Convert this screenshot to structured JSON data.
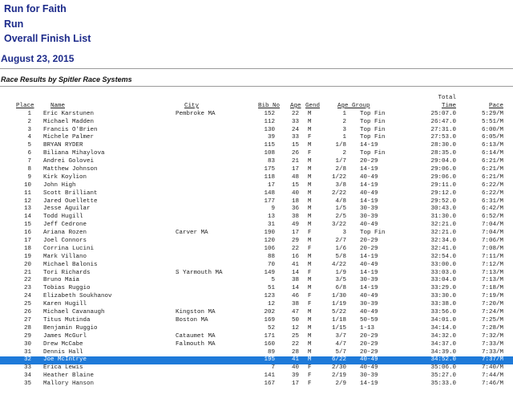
{
  "header": {
    "line1": "Run for Faith",
    "line2": "Run",
    "line3": "Overall Finish List",
    "date": "August 23, 2015",
    "subtitle": "Race Results by Spitler Race Systems"
  },
  "columns": {
    "place": "Place",
    "name": "Name",
    "city": "City",
    "bib": "Bib No",
    "age": "Age",
    "gend": "Gend",
    "group": "Age Group",
    "time_top": "Total",
    "time": "Time",
    "pace": "Pace"
  },
  "rows": [
    {
      "place": "1",
      "name": "Eric Karstunen",
      "city": "Pembroke  MA",
      "bib": "152",
      "age": "22",
      "gend": "M",
      "div": "1",
      "group": "Top Fin",
      "time": "25:07.0",
      "pace": "5:29/M"
    },
    {
      "place": "2",
      "name": "Michael Madden",
      "city": "",
      "bib": "112",
      "age": "33",
      "gend": "M",
      "div": "2",
      "group": "Top Fin",
      "time": "26:47.0",
      "pace": "5:51/M"
    },
    {
      "place": "3",
      "name": "Francis O'Brien",
      "city": "",
      "bib": "130",
      "age": "24",
      "gend": "M",
      "div": "3",
      "group": "Top Fin",
      "time": "27:31.0",
      "pace": "6:00/M"
    },
    {
      "place": "4",
      "name": "Michele Palmer",
      "city": "",
      "bib": "39",
      "age": "33",
      "gend": "F",
      "div": "1",
      "group": "Top Fin",
      "time": "27:53.0",
      "pace": "6:05/M"
    },
    {
      "place": "5",
      "name": "BRYAN RYDER",
      "city": "",
      "bib": "115",
      "age": "15",
      "gend": "M",
      "div": "1/8",
      "group": "14-19",
      "time": "28:30.0",
      "pace": "6:13/M"
    },
    {
      "place": "6",
      "name": "Biliana Mihaylova",
      "city": "",
      "bib": "108",
      "age": "26",
      "gend": "F",
      "div": "2",
      "group": "Top Fin",
      "time": "28:35.0",
      "pace": "6:14/M"
    },
    {
      "place": "7",
      "name": "Andrei Golovei",
      "city": "",
      "bib": "83",
      "age": "21",
      "gend": "M",
      "div": "1/7",
      "group": "20-29",
      "time": "29:04.0",
      "pace": "6:21/M"
    },
    {
      "place": "8",
      "name": "Matthew Johnson",
      "city": "",
      "bib": "175",
      "age": "17",
      "gend": "M",
      "div": "2/8",
      "group": "14-19",
      "time": "29:06.0",
      "pace": "6:21/M"
    },
    {
      "place": "9",
      "name": "Kirk Koylion",
      "city": "",
      "bib": "118",
      "age": "48",
      "gend": "M",
      "div": "1/22",
      "group": "40-49",
      "time": "29:06.0",
      "pace": "6:21/M"
    },
    {
      "place": "10",
      "name": "John High",
      "city": "",
      "bib": "17",
      "age": "15",
      "gend": "M",
      "div": "3/8",
      "group": "14-19",
      "time": "29:11.0",
      "pace": "6:22/M"
    },
    {
      "place": "11",
      "name": "Scott Brilliant",
      "city": "",
      "bib": "148",
      "age": "40",
      "gend": "M",
      "div": "2/22",
      "group": "40-49",
      "time": "29:12.0",
      "pace": "6:22/M"
    },
    {
      "place": "12",
      "name": "Jared Ouellette",
      "city": "",
      "bib": "177",
      "age": "18",
      "gend": "M",
      "div": "4/8",
      "group": "14-19",
      "time": "29:52.0",
      "pace": "6:31/M"
    },
    {
      "place": "13",
      "name": "Jesse Aguilar",
      "city": "",
      "bib": "9",
      "age": "36",
      "gend": "M",
      "div": "1/5",
      "group": "30-39",
      "time": "30:43.0",
      "pace": "6:42/M"
    },
    {
      "place": "14",
      "name": "Todd Hugill",
      "city": "",
      "bib": "13",
      "age": "38",
      "gend": "M",
      "div": "2/5",
      "group": "30-39",
      "time": "31:30.0",
      "pace": "6:52/M"
    },
    {
      "place": "15",
      "name": "Jeff Cedrone",
      "city": "",
      "bib": "31",
      "age": "49",
      "gend": "M",
      "div": "3/22",
      "group": "40-49",
      "time": "32:21.0",
      "pace": "7:04/M"
    },
    {
      "place": "16",
      "name": "Ariana Rozen",
      "city": "Carver  MA",
      "bib": "190",
      "age": "17",
      "gend": "F",
      "div": "3",
      "group": "Top Fin",
      "time": "32:21.0",
      "pace": "7:04/M"
    },
    {
      "place": "17",
      "name": "Joel Connors",
      "city": "",
      "bib": "120",
      "age": "29",
      "gend": "M",
      "div": "2/7",
      "group": "20-29",
      "time": "32:34.0",
      "pace": "7:06/M"
    },
    {
      "place": "18",
      "name": "Corrina Lucini",
      "city": "",
      "bib": "106",
      "age": "22",
      "gend": "F",
      "div": "1/6",
      "group": "20-29",
      "time": "32:41.0",
      "pace": "7:08/M"
    },
    {
      "place": "19",
      "name": "Mark Villano",
      "city": "",
      "bib": "88",
      "age": "16",
      "gend": "M",
      "div": "5/8",
      "group": "14-19",
      "time": "32:54.0",
      "pace": "7:11/M"
    },
    {
      "place": "20",
      "name": "Michael Balonis",
      "city": "",
      "bib": "70",
      "age": "41",
      "gend": "M",
      "div": "4/22",
      "group": "40-49",
      "time": "33:00.0",
      "pace": "7:12/M"
    },
    {
      "place": "21",
      "name": "Tori Richards",
      "city": "S Yarmouth  MA",
      "bib": "149",
      "age": "14",
      "gend": "F",
      "div": "1/9",
      "group": "14-19",
      "time": "33:03.0",
      "pace": "7:13/M"
    },
    {
      "place": "22",
      "name": "Bruno Maia",
      "city": "",
      "bib": "5",
      "age": "38",
      "gend": "M",
      "div": "3/5",
      "group": "30-39",
      "time": "33:04.0",
      "pace": "7:13/M"
    },
    {
      "place": "23",
      "name": "Tobias Ruggio",
      "city": "",
      "bib": "51",
      "age": "14",
      "gend": "M",
      "div": "6/8",
      "group": "14-19",
      "time": "33:29.0",
      "pace": "7:18/M"
    },
    {
      "place": "24",
      "name": "Elizabeth Soukhanov",
      "city": "",
      "bib": "123",
      "age": "46",
      "gend": "F",
      "div": "1/30",
      "group": "40-49",
      "time": "33:30.0",
      "pace": "7:19/M"
    },
    {
      "place": "25",
      "name": "Karen Hugill",
      "city": "",
      "bib": "12",
      "age": "38",
      "gend": "F",
      "div": "1/19",
      "group": "30-39",
      "time": "33:38.0",
      "pace": "7:20/M"
    },
    {
      "place": "26",
      "name": "Michael Cavanaugh",
      "city": "Kingston  MA",
      "bib": "202",
      "age": "47",
      "gend": "M",
      "div": "5/22",
      "group": "40-49",
      "time": "33:56.0",
      "pace": "7:24/M"
    },
    {
      "place": "27",
      "name": "Titus Mutinda",
      "city": "Boston  MA",
      "bib": "169",
      "age": "50",
      "gend": "M",
      "div": "1/18",
      "group": "50-59",
      "time": "34:01.0",
      "pace": "7:25/M"
    },
    {
      "place": "28",
      "name": "Benjamin Ruggio",
      "city": "",
      "bib": "52",
      "age": "12",
      "gend": "M",
      "div": "1/15",
      "group": "1-13",
      "time": "34:14.0",
      "pace": "7:28/M"
    },
    {
      "place": "29",
      "name": "James McGurl",
      "city": "Cataumet  MA",
      "bib": "171",
      "age": "25",
      "gend": "M",
      "div": "3/7",
      "group": "20-29",
      "time": "34:32.0",
      "pace": "7:32/M"
    },
    {
      "place": "30",
      "name": "Drew McCabe",
      "city": "Falmouth  MA",
      "bib": "160",
      "age": "22",
      "gend": "M",
      "div": "4/7",
      "group": "20-29",
      "time": "34:37.0",
      "pace": "7:33/M"
    },
    {
      "place": "31",
      "name": "Dennis Hall",
      "city": "",
      "bib": "89",
      "age": "28",
      "gend": "M",
      "div": "5/7",
      "group": "20-29",
      "time": "34:39.0",
      "pace": "7:33/M"
    },
    {
      "place": "32",
      "name": "Joe McIntrye",
      "city": "",
      "bib": "195",
      "age": "41",
      "gend": "M",
      "div": "6/22",
      "group": "40-49",
      "time": "34:52.0",
      "pace": "7:37/M"
    },
    {
      "place": "33",
      "name": "Erica Lewis",
      "city": "",
      "bib": "7",
      "age": "40",
      "gend": "F",
      "div": "2/30",
      "group": "40-49",
      "time": "35:06.0",
      "pace": "7:40/M"
    },
    {
      "place": "34",
      "name": "Heather Blaine",
      "city": "",
      "bib": "141",
      "age": "39",
      "gend": "F",
      "div": "2/19",
      "group": "30-39",
      "time": "35:27.0",
      "pace": "7:44/M"
    },
    {
      "place": "35",
      "name": "Mallory Hanson",
      "city": "",
      "bib": "167",
      "age": "17",
      "gend": "F",
      "div": "2/9",
      "group": "14-19",
      "time": "35:33.0",
      "pace": "7:46/M"
    }
  ],
  "selected_place": "32",
  "colors": {
    "header_text": "#1c2a8a",
    "selection": "#1e7ad9",
    "rule": "#9a9a9a"
  }
}
